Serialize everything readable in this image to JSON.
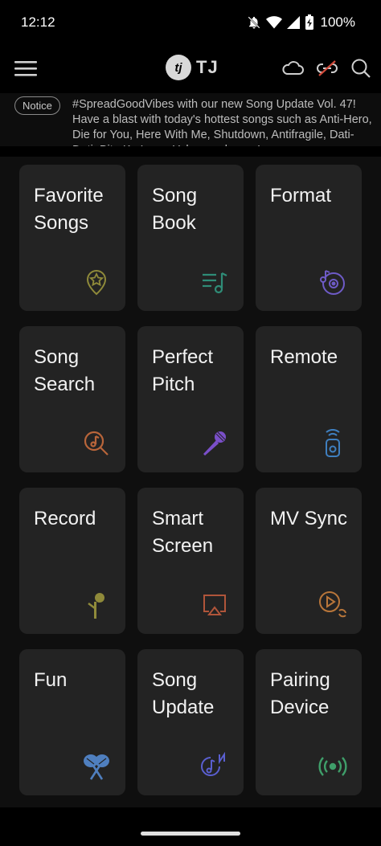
{
  "status_bar": {
    "time": "12:12",
    "battery": "100%",
    "icons": [
      "bell-off-icon",
      "wifi-icon",
      "signal-icon",
      "battery-charging-icon"
    ]
  },
  "app_bar": {
    "logo_text": "TJ",
    "logo_badge": "tj",
    "menu_icon": "hamburger-menu-icon",
    "action_icons": [
      "cloud-icon",
      "link-off-icon",
      "search-icon"
    ]
  },
  "notice": {
    "badge": "Notice",
    "text": "#SpreadGoodVibes with our new Song Update Vol. 47! Have a blast with today's hottest songs such as Anti-Hero, Die for You, Here With Me, Shutdown, Antifragile, Dati-Dati, Bite Ko Lang, Yakap and more!"
  },
  "tiles": [
    {
      "label": "Favorite Songs",
      "icon": "favorite-star-pin-icon",
      "color": "#8f8a3a"
    },
    {
      "label": "Song Book",
      "icon": "song-list-icon",
      "color": "#2f8c77"
    },
    {
      "label": "Format",
      "icon": "disc-music-icon",
      "color": "#6e5bc7"
    },
    {
      "label": "Song Search",
      "icon": "music-search-icon",
      "color": "#b8653a"
    },
    {
      "label": "Perfect Pitch",
      "icon": "microphone-icon",
      "color": "#7a4fc9"
    },
    {
      "label": "Remote",
      "icon": "remote-icon",
      "color": "#3f7fbf"
    },
    {
      "label": "Record",
      "icon": "record-mic-icon",
      "color": "#8f8a3a"
    },
    {
      "label": "Smart Screen",
      "icon": "cast-screen-icon",
      "color": "#b0553a"
    },
    {
      "label": "MV Sync",
      "icon": "video-sync-icon",
      "color": "#b8763a"
    },
    {
      "label": "Fun",
      "icon": "maracas-icon",
      "color": "#4f7fbf"
    },
    {
      "label": "Song Update",
      "icon": "new-music-icon",
      "color": "#5a5fd0"
    },
    {
      "label": "Pairing Device",
      "icon": "broadcast-icon",
      "color": "#3f9f6a"
    }
  ]
}
